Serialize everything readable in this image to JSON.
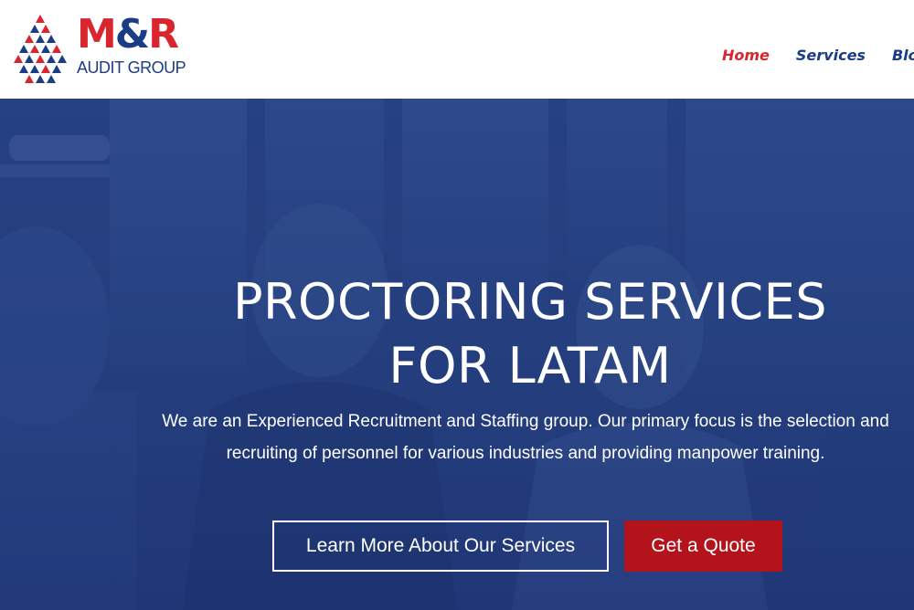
{
  "header": {
    "logo": {
      "brand_left": "M",
      "brand_amp": "&",
      "brand_right": "R",
      "sub": "AUDIT GROUP",
      "colors": {
        "red": "#d9262e",
        "blue": "#1b3c86"
      }
    },
    "nav": {
      "items": [
        {
          "label": "Home",
          "active": true
        },
        {
          "label": "Services",
          "active": false
        },
        {
          "label": "Blo",
          "active": false
        }
      ]
    }
  },
  "hero": {
    "title": "PROCTORING SERVICES\nFOR LATAM",
    "text": "We are an Experienced Recruitment and Staffing group. Our primary focus is the selection and recruiting of personnel for various industries and providing manpower training.",
    "buttons": {
      "learn_more": "Learn More About Our Services",
      "quote": "Get a Quote"
    },
    "colors": {
      "overlay": "#233f80",
      "button_primary": "#b3141b"
    }
  }
}
